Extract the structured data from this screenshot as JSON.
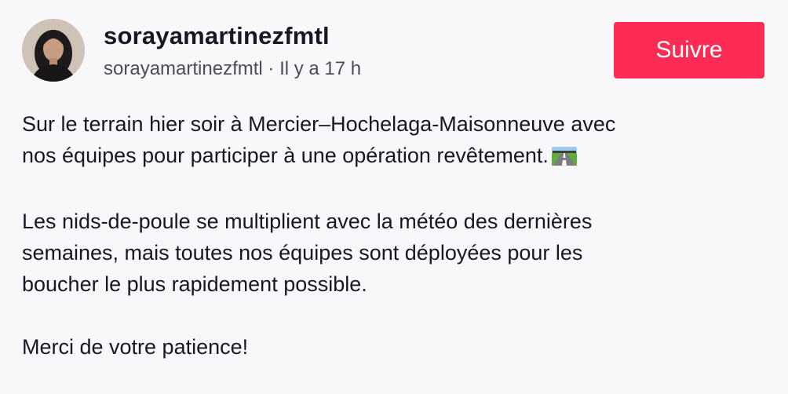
{
  "author": {
    "username": "sorayamartinezfmtl",
    "handle": "sorayamartinezfmtl",
    "separator": "·",
    "time_ago": "Il y a 17 h",
    "avatar_icon": "profile-photo"
  },
  "actions": {
    "follow_label": "Suivre",
    "follow_color": "#fe2c55"
  },
  "caption": {
    "paragraph1_line1": "Sur le terrain hier soir à Mercier–Hochelaga-Maisonneuve avec",
    "paragraph1_line2": "nos équipes pour participer à une opération revêtement.",
    "paragraph1_emoji": "motorway-emoji",
    "paragraph2": "Les nids-de-poule se multiplient avec la météo des dernières\nsemaines, mais toutes nos équipes sont déployées pour les\nboucher le plus rapidement possible.",
    "paragraph3": "Merci de votre patience!"
  }
}
